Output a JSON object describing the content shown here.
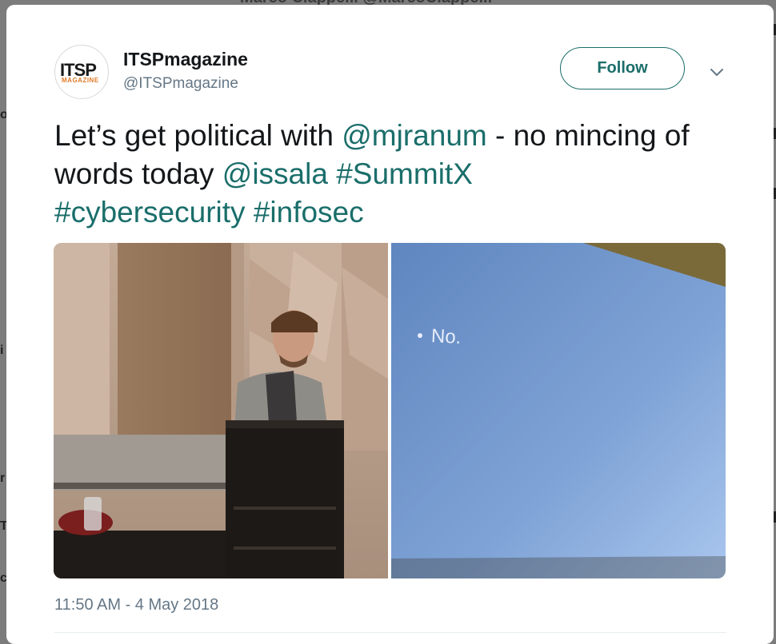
{
  "tweet": {
    "display_name": "ITSPmagazine",
    "handle": "@ITSPmagazine",
    "avatar": {
      "logo_text": "ITSP",
      "logo_sub": "MAGAZINE"
    },
    "follow_label": "Follow",
    "text_parts": {
      "p1": "Let’s get political with ",
      "mention1": "@mjranum",
      "p2": " - no mincing of words today ",
      "mention2": "@issala",
      "p3": " ",
      "hashtag1": "#SummitX",
      "p4": " ",
      "hashtag2": "#cybersecurity",
      "p5": " ",
      "hashtag3": "#infosec"
    },
    "slide_text": "No.",
    "timestamp": "11:50 AM - 4 May 2018"
  },
  "background": {
    "header_text": "Marco Ciappelli @MarcoCiappelli"
  },
  "colors": {
    "link": "#1a6e6a",
    "text": "#14171a",
    "muted": "#657786",
    "overlay": "#7c7c7c"
  },
  "icons": [
    "chevron-down-icon"
  ]
}
